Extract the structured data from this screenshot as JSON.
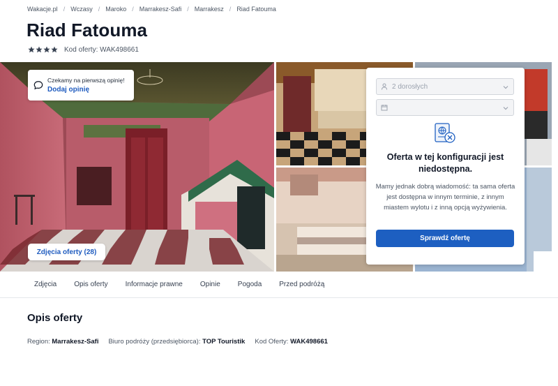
{
  "breadcrumb": [
    "Wakacje.pl",
    "Wczasy",
    "Maroko",
    "Marrakesz-Safi",
    "Marrakesz",
    "Riad Fatouma"
  ],
  "hotel": {
    "name": "Riad Fatouma",
    "stars": 4,
    "code_label": "Kod oferty: WAK498661"
  },
  "review_card": {
    "text": "Czekamy na pierwszą opinię!",
    "link": "Dodaj opinię"
  },
  "gallery": {
    "photos_button": "Zdjęcia oferty (28)"
  },
  "offer_panel": {
    "guests_value": "2 dorosłych",
    "date_value": "",
    "title": "Oferta w tej konfiguracji jest niedostępna.",
    "body": "Mamy jednak dobrą wiadomość: ta sama oferta jest dostępna w innym terminie, z innym miastem wylotu i z inną opcją wyżywienia.",
    "button": "Sprawdź ofertę"
  },
  "tabs": [
    "Zdjęcia",
    "Opis oferty",
    "Informacje prawne",
    "Opinie",
    "Pogoda",
    "Przed podróżą"
  ],
  "description": {
    "title": "Opis oferty",
    "region_label": "Region:",
    "region_value": "Marrakesz-Safi",
    "agency_label": "Biuro podróży (przedsiębiorca):",
    "agency_value": "TOP Touristik",
    "code_label": "Kod Oferty:",
    "code_value": "WAK498661"
  },
  "colors": {
    "accent": "#1d5fc1",
    "link": "#1e5bbf",
    "star": "#374151"
  },
  "icons": [
    "star-icon",
    "chat-bubble-icon",
    "person-icon",
    "calendar-icon",
    "chevron-down-icon",
    "offer-unavailable-icon"
  ]
}
